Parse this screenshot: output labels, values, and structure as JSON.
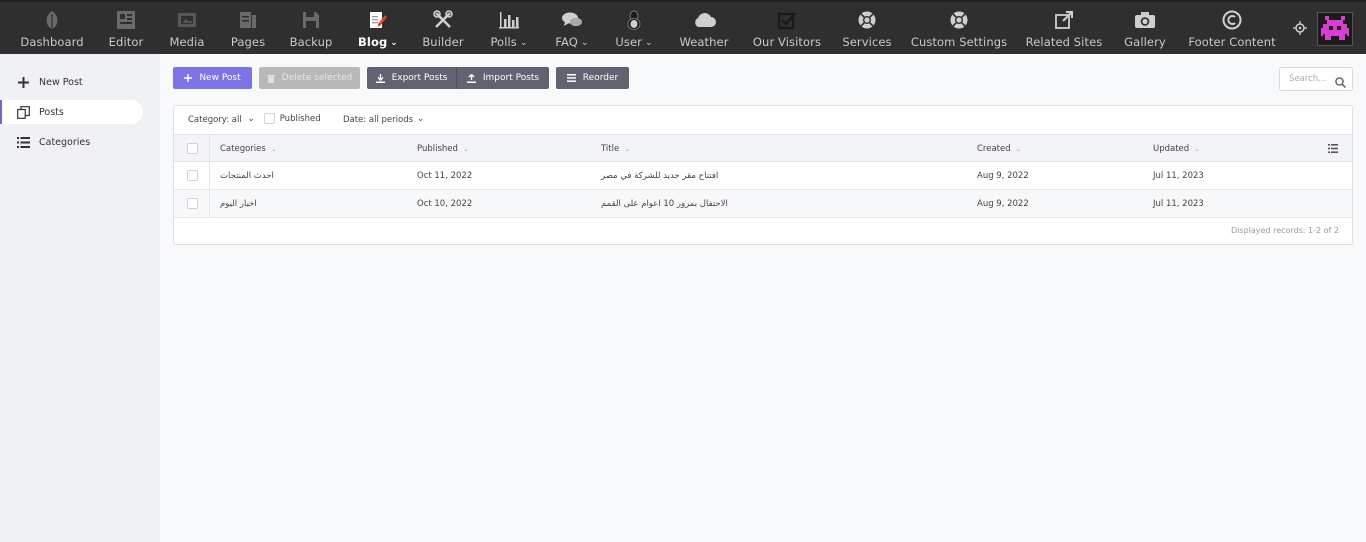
{
  "topnav": [
    {
      "label": "Dashboard",
      "icon": "leaf-icon"
    },
    {
      "label": "Editor",
      "icon": "editor-icon"
    },
    {
      "label": "Media",
      "icon": "media-icon"
    },
    {
      "label": "Pages",
      "icon": "pages-icon"
    },
    {
      "label": "Backup",
      "icon": "floppy-icon"
    },
    {
      "label": "Blog",
      "icon": "blog-edit-icon",
      "active": true,
      "dropdown": true
    },
    {
      "label": "Builder",
      "icon": "tools-icon"
    },
    {
      "label": "Polls",
      "icon": "bar-chart-icon",
      "dropdown": true
    },
    {
      "label": "FAQ",
      "icon": "chat-bubbles-icon",
      "dropdown": true
    },
    {
      "label": "User",
      "icon": "user-icon",
      "dropdown": true
    },
    {
      "label": "Weather",
      "icon": "cloud-icon"
    },
    {
      "label": "Our Visitors",
      "icon": "checkbox-icon"
    },
    {
      "label": "Services",
      "icon": "lifebuoy-icon"
    },
    {
      "label": "Custom Settings",
      "icon": "lifebuoy-icon"
    },
    {
      "label": "Related Sites",
      "icon": "external-link-icon"
    },
    {
      "label": "Gallery",
      "icon": "camera-icon"
    },
    {
      "label": "Footer Content",
      "icon": "copyright-icon"
    }
  ],
  "sidebar": {
    "items": [
      {
        "label": "New Post",
        "icon": "plus-icon"
      },
      {
        "label": "Posts",
        "icon": "copy-icon",
        "active": true
      },
      {
        "label": "Categories",
        "icon": "list-icon"
      }
    ]
  },
  "toolbar": {
    "new_post": "New Post",
    "delete_selected": "Delete selected",
    "export_posts": "Export Posts",
    "import_posts": "Import Posts",
    "reorder": "Reorder"
  },
  "search": {
    "placeholder": "Search..."
  },
  "filters": {
    "category_label": "Category:",
    "category_value": "all",
    "published": "Published",
    "date_label": "Date:",
    "date_value": "all periods"
  },
  "table": {
    "columns": [
      "Categories",
      "Published",
      "Title",
      "Created",
      "Updated"
    ],
    "rows": [
      {
        "category": "احدث المنتجات",
        "published": "Oct 11, 2022",
        "title": "افتتاح مقر جديد للشركة في مصر",
        "created": "Aug 9, 2022",
        "updated": "Jul 11, 2023"
      },
      {
        "category": "اخبار اليوم",
        "published": "Oct 10, 2022",
        "title": "الاحتفال بمرور 10 اعوام على القمم",
        "created": "Aug 9, 2022",
        "updated": "Jul 11, 2023"
      }
    ],
    "footer": "Displayed records: 1-2 of 2"
  },
  "colors": {
    "topbar": "#2f2f2f",
    "primary": "#7b74e6",
    "avatar_accent": "#d63fd0"
  }
}
